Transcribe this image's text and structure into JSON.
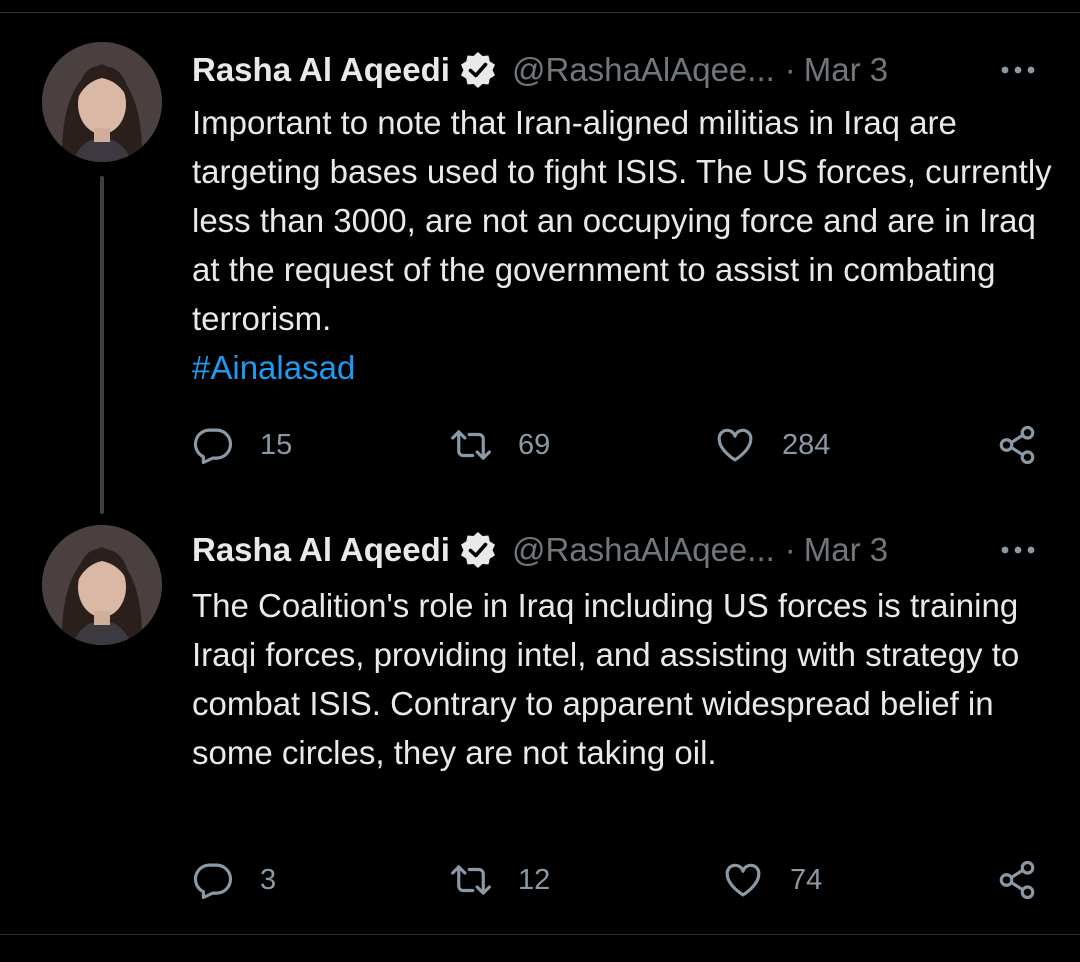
{
  "tweets": [
    {
      "author": {
        "name": "Rasha Al Aqeedi",
        "handle": "@RashaAlAqee...",
        "verified": true
      },
      "date": "Mar 3",
      "separator": "·",
      "text": "Important to note that Iran-aligned militias in Iraq are targeting bases used to fight ISIS.   The US forces, currently less than 3000, are not an occupying force and are in Iraq at the request of the government to assist in combating terrorism.",
      "hashtag": "#Ainalasad",
      "stats": {
        "replies": "15",
        "retweets": "69",
        "likes": "284"
      }
    },
    {
      "author": {
        "name": "Rasha Al Aqeedi",
        "handle": "@RashaAlAqee...",
        "verified": true
      },
      "date": "Mar 3",
      "separator": "·",
      "text": "The Coalition's role in Iraq including US forces is training Iraqi forces, providing intel, and assisting with strategy to combat ISIS. Contrary to apparent widespread belief in some circles, they are not taking oil.",
      "hashtag": "",
      "stats": {
        "replies": "3",
        "retweets": "12",
        "likes": "74"
      }
    }
  ],
  "icons": {
    "reply": "reply-icon",
    "retweet": "retweet-icon",
    "like": "heart-icon",
    "share": "share-icon",
    "more": "more-options-icon",
    "verified": "verified-badge-icon"
  },
  "colors": {
    "background": "#000000",
    "text": "#e7e9ea",
    "secondary": "#71767b",
    "link": "#1d9bf0"
  }
}
